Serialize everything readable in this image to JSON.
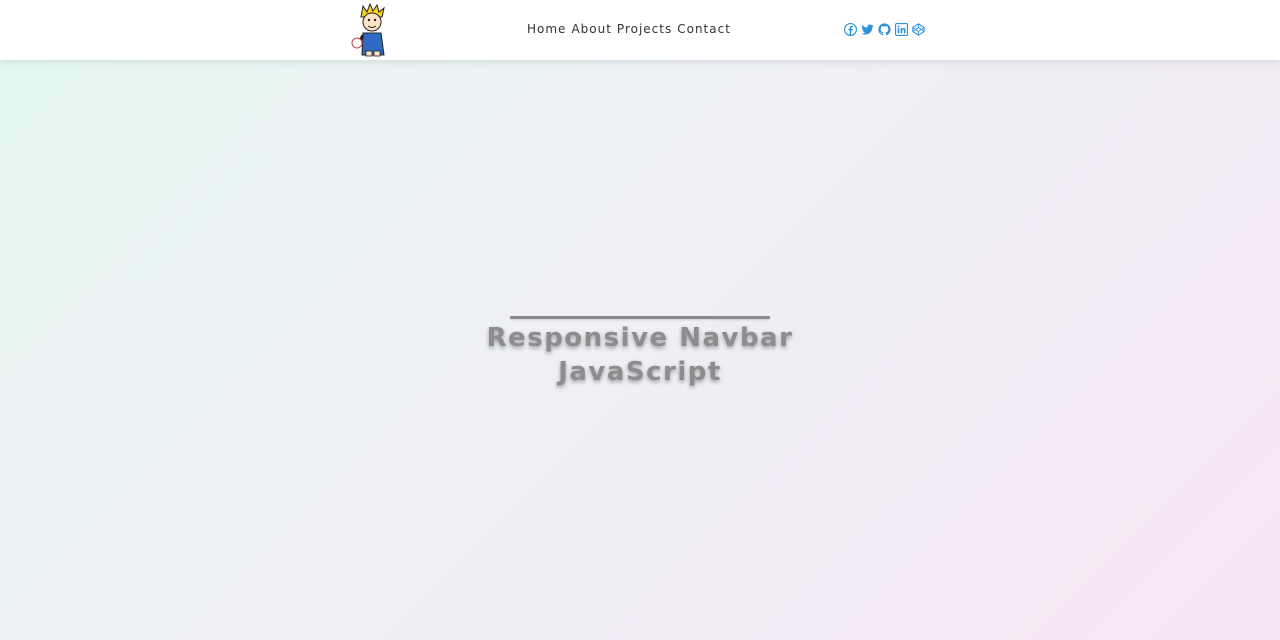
{
  "navbar": {
    "logo_icon": "cartoon-boy-logo",
    "links": [
      {
        "label": "Home"
      },
      {
        "label": "About"
      },
      {
        "label": "Projects"
      },
      {
        "label": "Contact"
      }
    ],
    "social_icons": [
      "facebook-icon",
      "twitter-icon",
      "github-icon",
      "linkedin-icon",
      "codepen-icon"
    ],
    "social_icon_color": "#2f8fd8"
  },
  "hero": {
    "title_line1": "Responsive Navbar",
    "title_line2": "JavaScript"
  },
  "colors": {
    "background_start": "#e5f8f2",
    "background_end": "#f7e6f4",
    "title_text": "#8d8d8d"
  }
}
